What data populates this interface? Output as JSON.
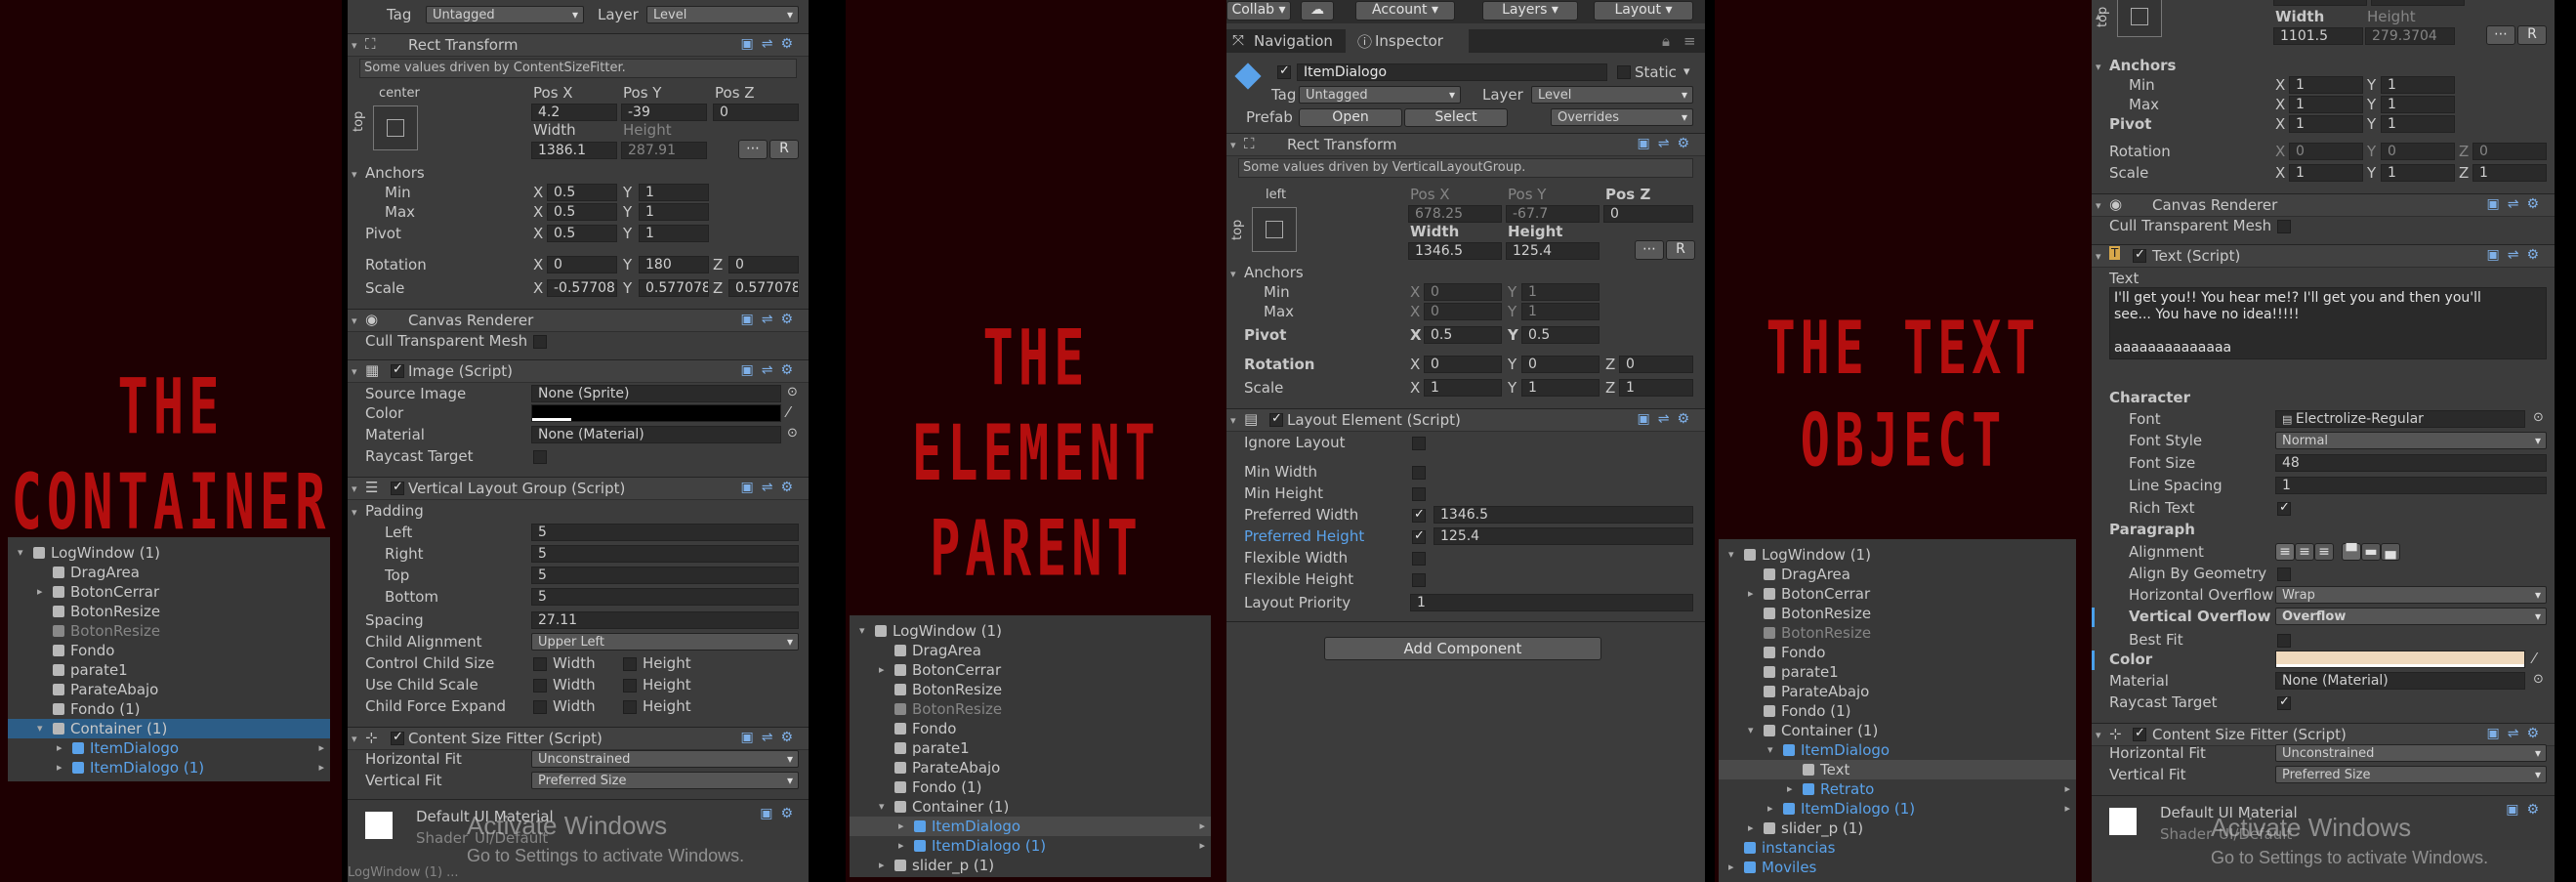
{
  "labels": {
    "container": [
      "THE",
      "CONTAINER"
    ],
    "element_parent": [
      "THE",
      "ELEMENT",
      "PARENT"
    ],
    "text_object": [
      "THE TEXT",
      "OBJECT"
    ]
  },
  "colors": {
    "bg_red": "#1e0002",
    "title_red": "#b40e0e",
    "unity_panel": "#3c3c3c",
    "selection": "#2c5d87",
    "prefab_blue": "#5aa2ea"
  },
  "watermark": {
    "title": "Activate Windows",
    "subtitle": "Go to Settings to activate Windows."
  },
  "panel1": {
    "tag_label": "Tag",
    "tag_value": "Untagged",
    "layer_label": "Layer",
    "layer_value": "Level",
    "rect_title": "Rect Transform",
    "driven_note": "Some values driven by ContentSizeFitter.",
    "anchor_preset": "center",
    "anchor_side": "top",
    "posx_label": "Pos X",
    "posy_label": "Pos Y",
    "posz_label": "Pos Z",
    "posx": "4.2",
    "posy": "-39",
    "posz": "0",
    "width_label": "Width",
    "height_label": "Height",
    "width": "1386.1",
    "height": "287.91",
    "anchors": "Anchors",
    "min": "Min",
    "max": "Max",
    "pivot": "Pivot",
    "rotation": "Rotation",
    "scale": "Scale",
    "x": "X",
    "y": "Y",
    "z": "Z",
    "min_x": "0.5",
    "min_y": "1",
    "max_x": "0.5",
    "max_y": "1",
    "pivot_x": "0.5",
    "pivot_y": "1",
    "rot_x": "0",
    "rot_y": "180",
    "rot_z": "0",
    "scale_x": "-0.57708",
    "scale_y": "0.577078",
    "scale_z": "0.577078",
    "raw_btn": "R",
    "canvas_renderer": "Canvas Renderer",
    "cull": "Cull Transparent Mesh",
    "image_title": "Image (Script)",
    "source_image": "Source Image",
    "source_value": "None (Sprite)",
    "color": "Color",
    "material": "Material",
    "material_value": "None (Material)",
    "raycast": "Raycast Target",
    "vlg_title": "Vertical Layout Group (Script)",
    "padding": "Padding",
    "left": "Left",
    "right": "Right",
    "top": "Top",
    "bottom": "Bottom",
    "pad_left": "5",
    "pad_right": "5",
    "pad_top": "5",
    "pad_bottom": "5",
    "spacing": "Spacing",
    "spacing_value": "27.11",
    "child_alignment": "Child Alignment",
    "child_alignment_value": "Upper Left",
    "control_child_size": "Control Child Size",
    "use_child_scale": "Use Child Scale",
    "child_force_expand": "Child Force Expand",
    "w": "Width",
    "h": "Height",
    "csf_title": "Content Size Fitter (Script)",
    "hfit": "Horizontal Fit",
    "hfit_value": "Unconstrained",
    "vfit": "Vertical Fit",
    "vfit_value": "Preferred Size",
    "default_mat": "Default UI Material",
    "shader": "Shader",
    "shader_value": "UI/Default",
    "footer_clip": "LogWindow (1) ..."
  },
  "hierarchy1": {
    "items": [
      {
        "label": "LogWindow (1)",
        "indent": 0,
        "arrow": "▾",
        "kind": "root"
      },
      {
        "label": "DragArea",
        "indent": 1,
        "arrow": "",
        "kind": "g"
      },
      {
        "label": "BotonCerrar",
        "indent": 1,
        "arrow": "▸",
        "kind": "g"
      },
      {
        "label": "BotonResize",
        "indent": 1,
        "arrow": "",
        "kind": "g"
      },
      {
        "label": "BotonResize",
        "indent": 1,
        "arrow": "",
        "kind": "dim"
      },
      {
        "label": "Fondo",
        "indent": 1,
        "arrow": "",
        "kind": "g"
      },
      {
        "label": "parate1",
        "indent": 1,
        "arrow": "",
        "kind": "g"
      },
      {
        "label": "ParateAbajo",
        "indent": 1,
        "arrow": "",
        "kind": "g"
      },
      {
        "label": "Fondo (1)",
        "indent": 1,
        "arrow": "",
        "kind": "g"
      },
      {
        "label": "Container (1)",
        "indent": 1,
        "arrow": "▾",
        "kind": "sel"
      },
      {
        "label": "ItemDialogo",
        "indent": 2,
        "arrow": "▸",
        "kind": "b"
      },
      {
        "label": "ItemDialogo (1)",
        "indent": 2,
        "arrow": "▸",
        "kind": "b"
      }
    ]
  },
  "hierarchy2": {
    "items": [
      {
        "label": "LogWindow (1)",
        "indent": 0,
        "arrow": "▾",
        "kind": "root"
      },
      {
        "label": "DragArea",
        "indent": 1,
        "arrow": "",
        "kind": "g"
      },
      {
        "label": "BotonCerrar",
        "indent": 1,
        "arrow": "▸",
        "kind": "g"
      },
      {
        "label": "BotonResize",
        "indent": 1,
        "arrow": "",
        "kind": "g"
      },
      {
        "label": "BotonResize",
        "indent": 1,
        "arrow": "",
        "kind": "dim"
      },
      {
        "label": "Fondo",
        "indent": 1,
        "arrow": "",
        "kind": "g"
      },
      {
        "label": "parate1",
        "indent": 1,
        "arrow": "",
        "kind": "g"
      },
      {
        "label": "ParateAbajo",
        "indent": 1,
        "arrow": "",
        "kind": "g"
      },
      {
        "label": "Fondo (1)",
        "indent": 1,
        "arrow": "",
        "kind": "g"
      },
      {
        "label": "Container (1)",
        "indent": 1,
        "arrow": "▾",
        "kind": "g"
      },
      {
        "label": "ItemDialogo",
        "indent": 2,
        "arrow": "▸",
        "kind": "bsel"
      },
      {
        "label": "ItemDialogo (1)",
        "indent": 2,
        "arrow": "▸",
        "kind": "b"
      },
      {
        "label": "slider_p (1)",
        "indent": 1,
        "arrow": "▸",
        "kind": "g"
      }
    ]
  },
  "hierarchy3": {
    "items": [
      {
        "label": "LogWindow (1)",
        "indent": 0,
        "arrow": "▾",
        "kind": "root"
      },
      {
        "label": "DragArea",
        "indent": 1,
        "arrow": "",
        "kind": "g"
      },
      {
        "label": "BotonCerrar",
        "indent": 1,
        "arrow": "▸",
        "kind": "g"
      },
      {
        "label": "BotonResize",
        "indent": 1,
        "arrow": "",
        "kind": "g"
      },
      {
        "label": "BotonResize",
        "indent": 1,
        "arrow": "",
        "kind": "dim"
      },
      {
        "label": "Fondo",
        "indent": 1,
        "arrow": "",
        "kind": "g"
      },
      {
        "label": "parate1",
        "indent": 1,
        "arrow": "",
        "kind": "g"
      },
      {
        "label": "ParateAbajo",
        "indent": 1,
        "arrow": "",
        "kind": "g"
      },
      {
        "label": "Fondo (1)",
        "indent": 1,
        "arrow": "",
        "kind": "g"
      },
      {
        "label": "Container (1)",
        "indent": 1,
        "arrow": "▾",
        "kind": "g"
      },
      {
        "label": "ItemDialogo",
        "indent": 2,
        "arrow": "▾",
        "kind": "b"
      },
      {
        "label": "Text",
        "indent": 3,
        "arrow": "",
        "kind": "gsel"
      },
      {
        "label": "Retrato",
        "indent": 3,
        "arrow": "▸",
        "kind": "b"
      },
      {
        "label": "ItemDialogo (1)",
        "indent": 2,
        "arrow": "▸",
        "kind": "b"
      },
      {
        "label": "slider_p (1)",
        "indent": 1,
        "arrow": "▸",
        "kind": "g"
      },
      {
        "label": "instancias",
        "indent": 0,
        "arrow": "",
        "kind": "b"
      },
      {
        "label": "Moviles",
        "indent": 0,
        "arrow": "▸",
        "kind": "b"
      }
    ]
  },
  "panel2": {
    "toolbar": {
      "collab": "Collab",
      "account": "Account",
      "layers": "Layers",
      "layout": "Layout"
    },
    "tab_navigation": "Navigation",
    "tab_inspector": "Inspector",
    "object_name": "ItemDialogo",
    "static_label": "Static",
    "tag_label": "Tag",
    "tag_value": "Untagged",
    "layer_label": "Layer",
    "layer_value": "Level",
    "prefab_label": "Prefab",
    "open_btn": "Open",
    "select_btn": "Select",
    "overrides": "Overrides",
    "rect_title": "Rect Transform",
    "driven_note": "Some values driven by VerticalLayoutGroup.",
    "anchor_preset": "left",
    "anchor_side": "top",
    "posx_label": "Pos X",
    "posy_label": "Pos Y",
    "posz_label": "Pos Z",
    "posx": "678.25",
    "posy": "-67.7",
    "posz": "0",
    "width_label": "Width",
    "height_label": "Height",
    "width": "1346.5",
    "height": "125.4",
    "anchors": "Anchors",
    "min": "Min",
    "max": "Max",
    "pivot": "Pivot",
    "rotation": "Rotation",
    "scale": "Scale",
    "x": "X",
    "y": "Y",
    "z": "Z",
    "min_x": "0",
    "min_y": "1",
    "max_x": "0",
    "max_y": "1",
    "pivot_x": "0.5",
    "pivot_y": "0.5",
    "rot_x": "0",
    "rot_y": "0",
    "rot_z": "0",
    "scale_x": "1",
    "scale_y": "1",
    "scale_z": "1",
    "raw_btn": "R",
    "le_title": "Layout Element (Script)",
    "ignore_layout": "Ignore Layout",
    "min_width": "Min Width",
    "min_height": "Min Height",
    "pref_width": "Preferred Width",
    "pref_width_value": "1346.5",
    "pref_height": "Preferred Height",
    "pref_height_value": "125.4",
    "flex_width": "Flexible Width",
    "flex_height": "Flexible Height",
    "layout_priority": "Layout Priority",
    "layout_priority_value": "1",
    "add_component": "Add Component"
  },
  "panel3": {
    "width_label": "Width",
    "height_label": "Height",
    "width": "1101.5",
    "height": "279.3704",
    "anchor_side": "top",
    "anchors": "Anchors",
    "min": "Min",
    "max": "Max",
    "pivot": "Pivot",
    "rotation": "Rotation",
    "scale": "Scale",
    "x": "X",
    "y": "Y",
    "z": "Z",
    "min_x": "1",
    "min_y": "1",
    "max_x": "1",
    "max_y": "1",
    "pivot_x": "1",
    "pivot_y": "1",
    "rot_x": "0",
    "rot_y": "0",
    "rot_z": "0",
    "scale_x": "1",
    "scale_y": "1",
    "scale_z": "1",
    "raw_btn": "R",
    "canvas_renderer": "Canvas Renderer",
    "cull": "Cull Transparent Mesh",
    "text_title": "Text (Script)",
    "text_label": "Text",
    "text_line1": "I'll get you!! You hear me!? I'll get you and then you'll",
    "text_line2": "see... You have no idea!!!!!",
    "text_line3": "aaaaaaaaaaaaaa",
    "character": "Character",
    "font": "Font",
    "font_value": "Electrolize-Regular",
    "font_style": "Font Style",
    "font_style_value": "Normal",
    "font_size": "Font Size",
    "font_size_value": "48",
    "line_spacing": "Line Spacing",
    "line_spacing_value": "1",
    "rich_text": "Rich Text",
    "paragraph": "Paragraph",
    "alignment": "Alignment",
    "align_geom": "Align By Geometry",
    "h_overflow": "Horizontal Overflow",
    "h_overflow_value": "Wrap",
    "v_overflow": "Vertical Overflow",
    "v_overflow_value": "Overflow",
    "best_fit": "Best Fit",
    "color": "Color",
    "material": "Material",
    "material_value": "None (Material)",
    "raycast": "Raycast Target",
    "csf_title": "Content Size Fitter (Script)",
    "hfit": "Horizontal Fit",
    "hfit_value": "Unconstrained",
    "vfit": "Vertical Fit",
    "vfit_value": "Preferred Size",
    "default_mat": "Default UI Material",
    "shader": "Shader",
    "shader_value": "UI/Default"
  }
}
